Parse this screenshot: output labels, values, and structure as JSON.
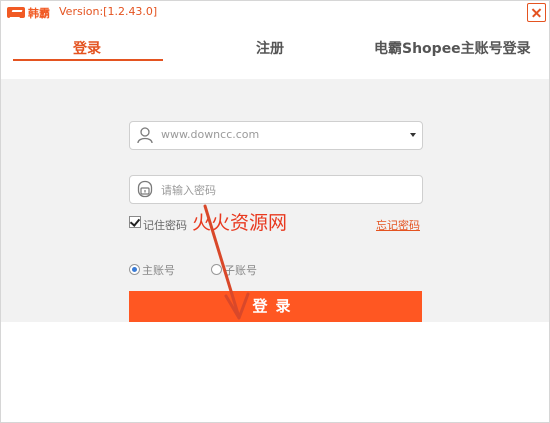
{
  "app": {
    "brand": "韩霸",
    "version": "Version:[1.2.43.0]"
  },
  "tabs": [
    {
      "label": "登录",
      "active": true
    },
    {
      "label": "注册",
      "active": false
    },
    {
      "label": "电霸Shopee主账号登录",
      "active": false
    }
  ],
  "form": {
    "username_value": "www.downcc.com",
    "password_placeholder": "请输入密码",
    "remember_label": "记住密码",
    "remember_checked": true,
    "forgot_label": "忘记密码",
    "account_types": [
      {
        "label": "主账号",
        "selected": true
      },
      {
        "label": "子账号",
        "selected": false
      }
    ],
    "login_label": "登录"
  },
  "overlay": {
    "watermark": "火火资源网"
  },
  "colors": {
    "accent": "#e45320",
    "button": "#ff5722",
    "panel": "#f2f2f2",
    "radio_selected": "#3a7bd5"
  }
}
